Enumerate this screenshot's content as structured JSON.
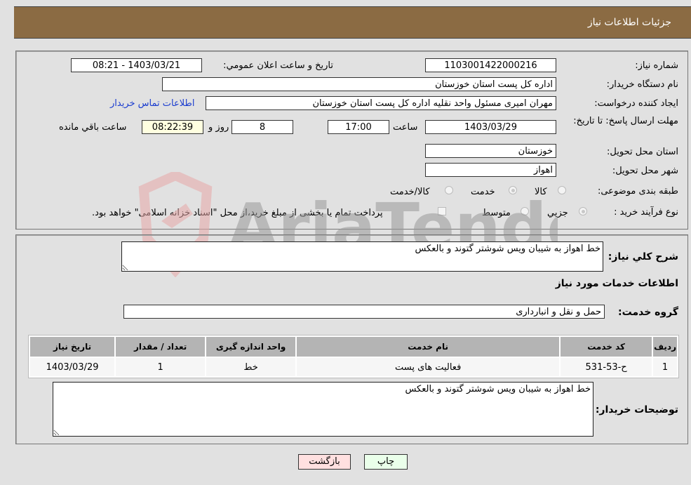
{
  "header": {
    "title": "جزئیات اطلاعات نیاز"
  },
  "form": {
    "need_number": {
      "label": "شماره نیاز:",
      "value": "1103001422000216"
    },
    "announce_datetime": {
      "label": "تاریخ و ساعت اعلان عمومي:",
      "value": "1403/03/21 - 08:21"
    },
    "buyer_org": {
      "label": "نام دستگاه خریدار:",
      "value": "اداره کل پست استان خوزستان"
    },
    "requester": {
      "label": "ایجاد کننده درخواست:",
      "value": "مهران امیری مسئول واحد نقلیه اداره کل پست استان خوزستان"
    },
    "buyer_contact_link": "اطلاعات تماس خریدار",
    "deadline": {
      "label": "مهلت ارسال پاسخ: تا تاریخ:",
      "date": "1403/03/29",
      "time_label": "ساعت",
      "time": "17:00",
      "days": "8",
      "days_label": "روز و",
      "remaining": "08:22:39",
      "remaining_label": "ساعت باقي مانده"
    },
    "province": {
      "label": "استان محل تحویل:",
      "value": "خوزستان"
    },
    "city": {
      "label": "شهر محل تحویل:",
      "value": "اهواز"
    },
    "category": {
      "label": "طبقه بندی موضوعی:",
      "options": [
        {
          "label": "کالا",
          "checked": false
        },
        {
          "label": "خدمت",
          "checked": true
        },
        {
          "label": "کالا/خدمت",
          "checked": false
        }
      ]
    },
    "process_type": {
      "label": "نوع فرآیند خرید :",
      "options": [
        {
          "label": "جزيي",
          "checked": true
        },
        {
          "label": "متوسط",
          "checked": false
        }
      ],
      "treasury_note": "پرداخت تمام یا بخشی از مبلغ خرید،از محل \"اسناد خزانه اسلامی\" خواهد بود."
    }
  },
  "details": {
    "summary_label": "شرح کلي نیاز:",
    "summary_value": "خط اهواز به شیبان ویس شوشتر گتوند و بالعکس",
    "services_heading": "اطلاعات خدمات مورد نیاز",
    "service_group_label": "گروه خدمت:",
    "service_group_value": "حمل و نقل و انبارداری",
    "table": {
      "headers": [
        "ردیف",
        "کد خدمت",
        "نام خدمت",
        "واحد اندازه گیری",
        "تعداد / مقدار",
        "تاریخ نیاز"
      ],
      "rows": [
        [
          "1",
          "ح-53-531",
          "فعالیت های پست",
          "خط",
          "1",
          "1403/03/29"
        ]
      ]
    },
    "buyer_notes_label": "توضیحات خریدار:",
    "buyer_notes_value": "خط اهواز به شیبان ویس شوشتر گتوند و بالعکس"
  },
  "buttons": {
    "print": "چاپ",
    "back": "بازگشت"
  },
  "watermark": {
    "text": "AriaTender.neT"
  }
}
